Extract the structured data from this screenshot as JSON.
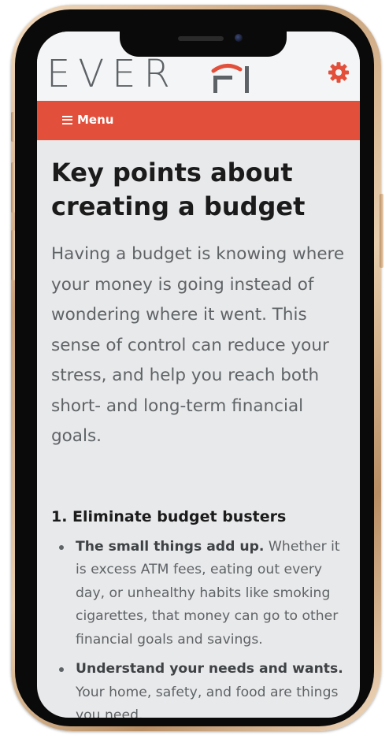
{
  "header": {
    "logo_text": "EVER",
    "logo_accent": "FI",
    "settings_icon": "gear-icon",
    "accent_color": "#e2503b",
    "logo_color": "#5d6266"
  },
  "menu_bar": {
    "menu_icon": "hamburger-icon",
    "menu_label": "Menu",
    "background_color": "#e2503b"
  },
  "main": {
    "title": "Key points about creating a budget",
    "intro": "Having a budget is knowing where your money is going instead of wondering where it went. This sense of control can reduce your stress, and help you reach both short- and long-term financial goals.",
    "section_heading": "1. Eliminate budget busters",
    "bullets": [
      {
        "bold": "The small things add up.",
        "text": " Whether it is excess ATM fees, eating out every day, or unhealthy habits like smoking cigarettes, that money can go to other financial goals and savings."
      },
      {
        "bold": "Understand your needs and wants.",
        "text": " Your home, safety, and food are things you need."
      }
    ]
  }
}
